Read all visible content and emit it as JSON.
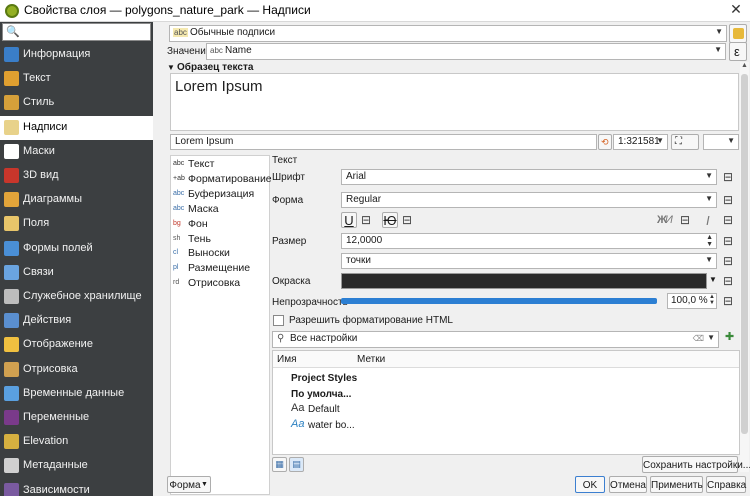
{
  "window": {
    "title": "Свойства слоя — polygons_nature_park — Надписи",
    "close_glyph": "✕"
  },
  "sidebar": {
    "search_glyph": "🔍",
    "items": [
      {
        "label": "Информация",
        "color": "#3a7ec8",
        "selected": false
      },
      {
        "label": "Текст",
        "color": "#e0a030",
        "selected": false
      },
      {
        "label": "Стиль",
        "color": "#d6a03a",
        "selected": false
      },
      {
        "label": "Надписи",
        "color": "#e8d28a",
        "selected": true
      },
      {
        "label": "Маски",
        "color": "#ffffff",
        "selected": false
      },
      {
        "label": "3D вид",
        "color": "#c8362b",
        "selected": false
      },
      {
        "label": "Диаграммы",
        "color": "#e2a43a",
        "selected": false
      },
      {
        "label": "Поля",
        "color": "#e8c56a",
        "selected": false
      },
      {
        "label": "Формы полей",
        "color": "#4a8fd6",
        "selected": false
      },
      {
        "label": "Связи",
        "color": "#6aa4e0",
        "selected": false
      },
      {
        "label": "Служебное хранилище",
        "color": "#bdbdbd",
        "selected": false
      },
      {
        "label": "Действия",
        "color": "#5a8fd0",
        "selected": false
      },
      {
        "label": "Отображение",
        "color": "#f0c040",
        "selected": false
      },
      {
        "label": "Отрисовка",
        "color": "#d0a050",
        "selected": false
      },
      {
        "label": "Временные данные",
        "color": "#5aa0e0",
        "selected": false
      },
      {
        "label": "Переменные",
        "color": "#7a3a8a",
        "selected": false
      },
      {
        "label": "Elevation",
        "color": "#d6b040",
        "selected": false
      },
      {
        "label": "Метаданные",
        "color": "#d0d0d0",
        "selected": false
      },
      {
        "label": "Зависимости",
        "color": "#7a5aa0",
        "selected": false
      }
    ]
  },
  "main": {
    "mode_combo": {
      "icon": "abc",
      "value": "Обычные подписи"
    },
    "value_row": {
      "label": "Значение",
      "icon": "abc",
      "value": "Name",
      "expr_glyph": "ε"
    },
    "section_title": "Образец текста",
    "preview_text": "Lorem Ipsum",
    "sample_input": "Lorem Ipsum",
    "scale": "1:321581",
    "tabs": [
      {
        "label": "Текст",
        "icon": "abc"
      },
      {
        "label": "Форматирование",
        "icon": "+ab"
      },
      {
        "label": "Буферизация",
        "icon": "abc"
      },
      {
        "label": "Маска",
        "icon": "abc"
      },
      {
        "label": "Фон",
        "icon": "bg"
      },
      {
        "label": "Тень",
        "icon": "sh"
      },
      {
        "label": "Выноски",
        "icon": "cl"
      },
      {
        "label": "Размещение",
        "icon": "pl"
      },
      {
        "label": "Отрисовка",
        "icon": "rd"
      }
    ],
    "text_group_title": "Текст",
    "font_label": "Шрифт",
    "font_value": "Arial",
    "style_label": "Форма",
    "style_value": "Regular",
    "underline_glyph": "U",
    "strike_glyph": "Ю",
    "bold_glyph": "Ж",
    "italic_glyph": "И",
    "italic_slash": "I",
    "size_label": "Размер",
    "size_value": "12,0000",
    "unit_value": "точки",
    "color_label": "Окраска",
    "color_value": "#2a2a2a",
    "opacity_label": "Непрозрачность",
    "opacity_value": "100,0 %",
    "opacity_fraction": 1.0,
    "html_checkbox_label": "Разрешить форматирование HTML",
    "styles_search_placeholder": "Все настройки",
    "styles_table": {
      "columns": [
        "Имя",
        "Метки"
      ],
      "rows": [
        {
          "name": "Project Styles",
          "bold": true,
          "icon": ""
        },
        {
          "name": "По умолча...",
          "bold": true,
          "icon": ""
        },
        {
          "name": "Default",
          "bold": false,
          "icon": "Aa"
        },
        {
          "name": "water bo...",
          "bold": false,
          "icon": "Aa"
        }
      ]
    },
    "save_settings_btn": "Сохранить настройки..."
  },
  "footer": {
    "form_btn": "Форма",
    "ok_btn": "OK",
    "cancel_btn": "Отмена",
    "apply_btn": "Применить",
    "help_btn": "Справка"
  }
}
